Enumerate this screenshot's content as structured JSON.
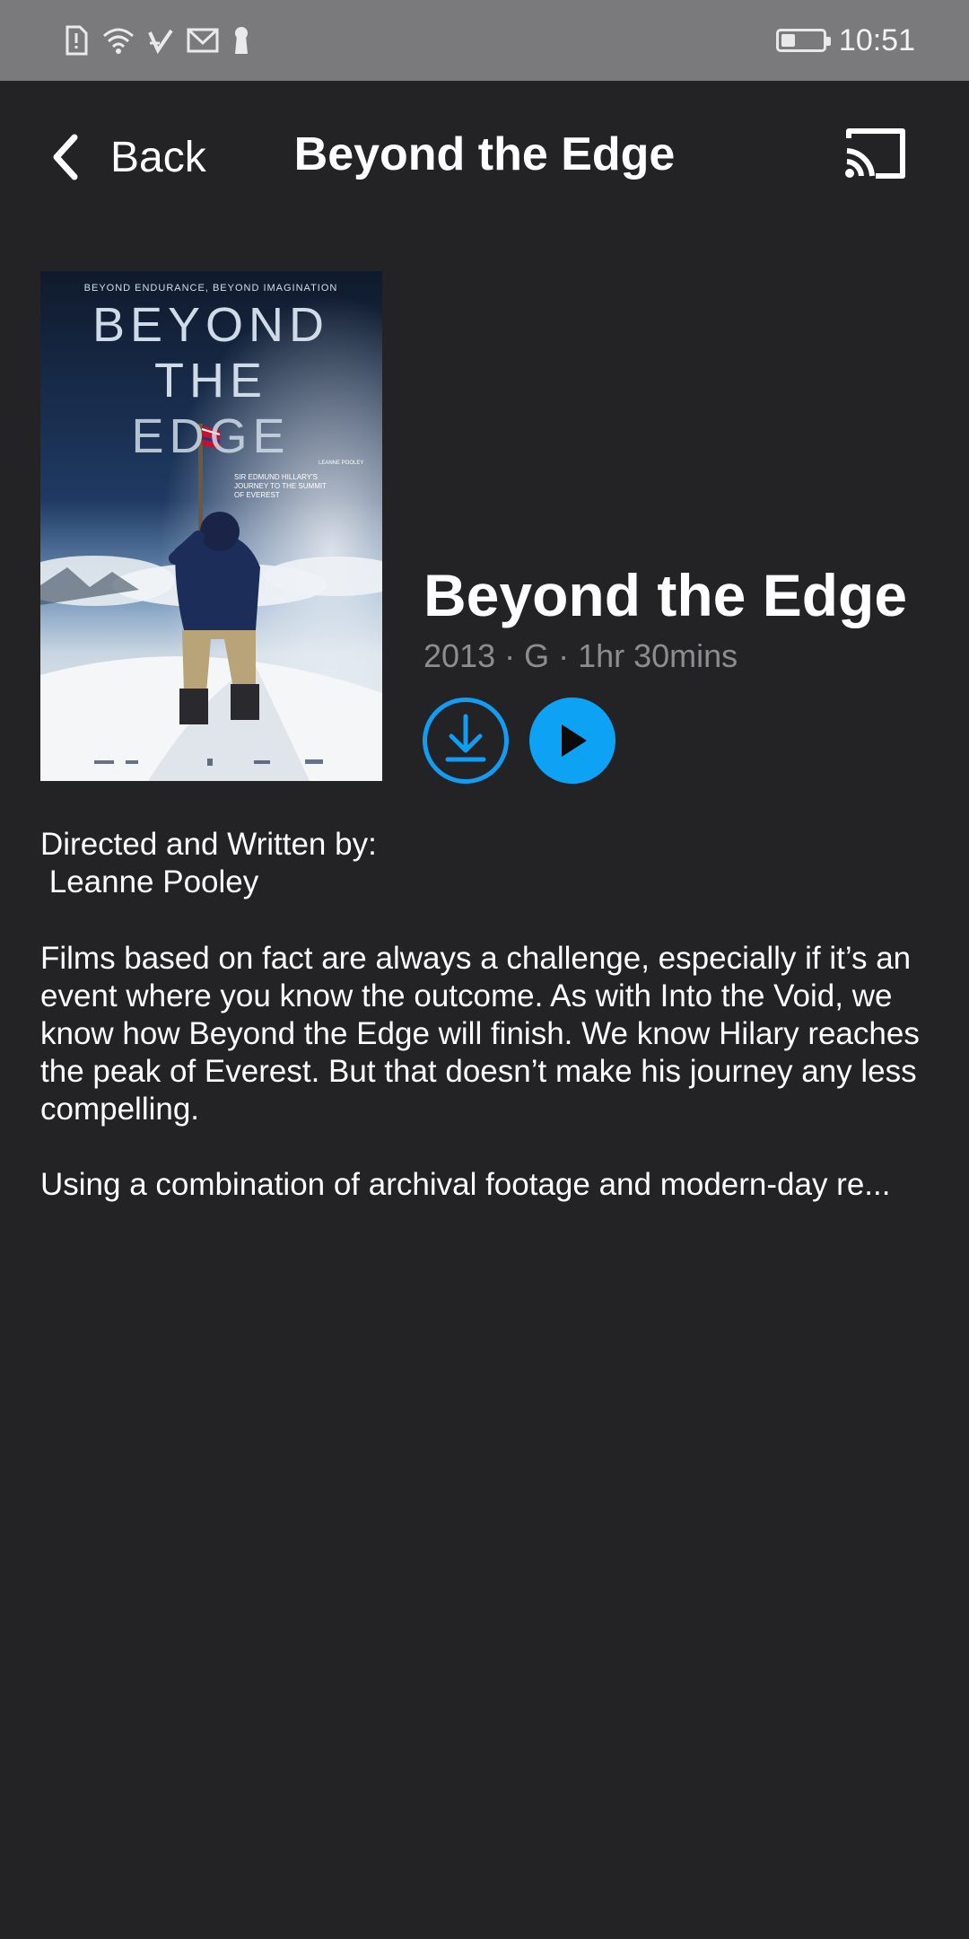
{
  "status_bar": {
    "time": "10:51",
    "icons": [
      "alert-sim-icon",
      "wifi-icon",
      "check-icon",
      "mail-icon",
      "keyhole-icon"
    ],
    "battery_level": 0.35
  },
  "header": {
    "back_label": "Back",
    "title": "Beyond the Edge"
  },
  "movie": {
    "title": "Beyond the Edge",
    "meta": "2013 · G · 1hr 30mins",
    "poster": {
      "tagline": "BEYOND ENDURANCE, BEYOND IMAGINATION",
      "title_line1": "BEYOND",
      "title_line2": "THE",
      "title_line3": "EDGE",
      "subtitle": "SIR EDMUND HILLARY'S JOURNEY TO THE SUMMIT OF EVEREST",
      "director_credit": "LEANNE POOLEY"
    }
  },
  "credits": {
    "line1": "Directed and Written by:",
    "line2": " Leanne Pooley"
  },
  "description": {
    "para1": "Films based on fact are always a challenge, especially if it’s an event where you know the outcome.  As with Into the Void, we know how Beyond the Edge will finish.  We know Hilary reaches the peak of Everest.  But that doesn’t make his journey any less compelling.",
    "para2": "Using a combination of archival footage and modern-day re..."
  },
  "colors": {
    "background": "#232225",
    "accent": "#0ea2f5",
    "status_bar": "#7a797c",
    "meta_text": "#8d8d90"
  }
}
